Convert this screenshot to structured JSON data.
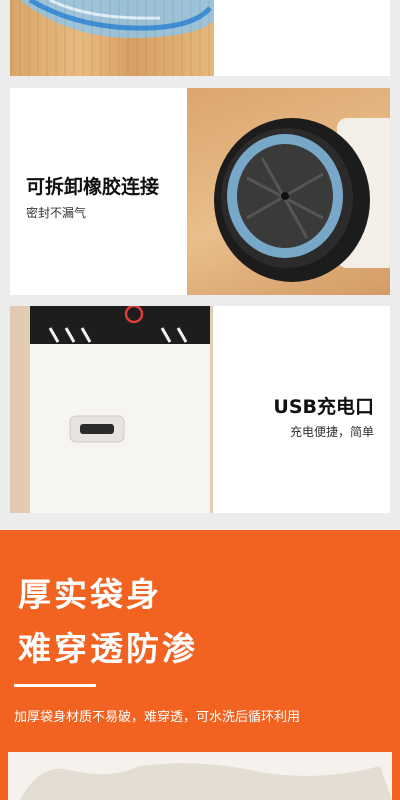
{
  "features": [
    {
      "title": "可拆卸橡胶连接",
      "subtitle": "密封不漏气"
    },
    {
      "title": "USB充电口",
      "subtitle": "充电便捷，简单"
    }
  ],
  "highlight": {
    "line1": "厚实袋身",
    "line2": "难穿透防渗",
    "description": "加厚袋身材质不易破，难穿透，可水洗后循环利用"
  },
  "colors": {
    "accent": "#f26322",
    "background": "#ececec",
    "card": "#ffffff"
  }
}
